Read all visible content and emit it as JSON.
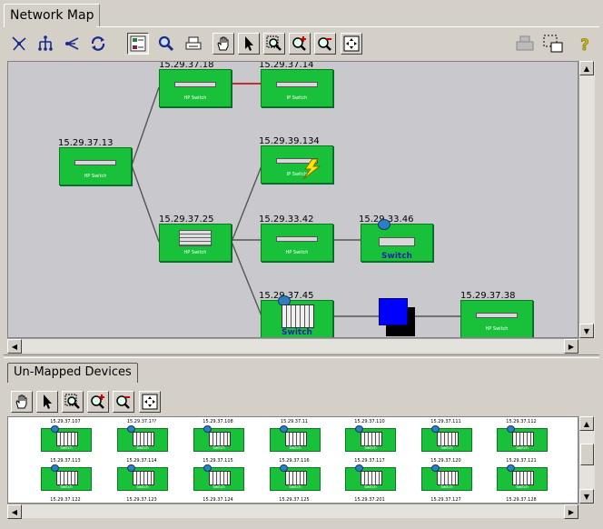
{
  "tabs": {
    "network_map": "Network Map",
    "unmapped": "Un-Mapped Devices"
  },
  "toolbar_top": [
    {
      "name": "star-layout-icon"
    },
    {
      "name": "tree-layout-icon"
    },
    {
      "name": "radial-layout-icon"
    },
    {
      "name": "refresh-icon"
    },
    {
      "name": "legend-icon"
    },
    {
      "name": "find-icon"
    },
    {
      "name": "print-icon"
    },
    {
      "name": "pan-hand-icon"
    },
    {
      "name": "select-arrow-icon"
    },
    {
      "name": "zoom-area-icon"
    },
    {
      "name": "zoom-in-icon"
    },
    {
      "name": "zoom-out-icon"
    },
    {
      "name": "fit-to-window-icon"
    }
  ],
  "toolbar_right": [
    {
      "name": "print-disabled-icon"
    },
    {
      "name": "select-region-icon"
    },
    {
      "name": "help-icon"
    }
  ],
  "colors": {
    "node_green": "#19c13a",
    "link_red": "#c03030",
    "link_gray": "#555555",
    "blue_node": "#0000ff"
  },
  "map": {
    "nodes": [
      {
        "id": "n1",
        "ip": "15.29.37.18",
        "caption": "HP Switch"
      },
      {
        "id": "n2",
        "ip": "15.29.37.14",
        "caption": "IP Switch"
      },
      {
        "id": "n3",
        "ip": "15.29.37.13",
        "caption": "HP Switch"
      },
      {
        "id": "n4",
        "ip": "15.29.39.134",
        "caption": "IP Switch"
      },
      {
        "id": "n5",
        "ip": "15.29.37.25",
        "caption": "HP Switch"
      },
      {
        "id": "n6",
        "ip": "15.29.33.42",
        "caption": "HP Switch"
      },
      {
        "id": "n7",
        "ip": "15.29.33.46",
        "caption": "Switch"
      },
      {
        "id": "n8",
        "ip": "15.29.37.45",
        "caption": "Switch"
      },
      {
        "id": "n9",
        "ip": "15.29.37.38",
        "caption": "HP Switch"
      }
    ]
  },
  "unmapped": {
    "row1": [
      "15.29.37.107",
      "15.29.37.1??",
      "15.29.37.108",
      "15.29.37.11",
      "15.29.37.110",
      "15.29.37.111",
      "15.29.37.112"
    ],
    "row2": [
      "15.29.37.113",
      "15.29.37.114",
      "15.29.37.115",
      "15.29.37.116",
      "15.29.37.117",
      "15.29.37.120",
      "15.29.37.121"
    ],
    "row3": [
      "15.29.37.122",
      "15.29.37.123",
      "15.29.37.124",
      "15.29.37.125",
      "15.29.37.201",
      "15.29.37.127",
      "15.29.37.128"
    ],
    "item_caption": "Switch"
  }
}
